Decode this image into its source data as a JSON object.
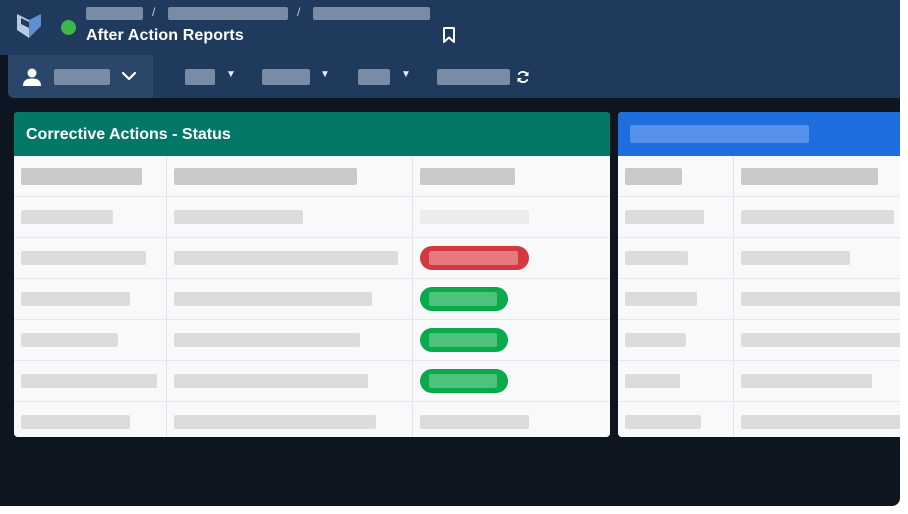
{
  "app": {
    "title": "After Action Reports",
    "breadcrumb_separator": "/",
    "status": "online",
    "colors": {
      "header_bg": "#1f3a5c",
      "status_green": "#3fb64b",
      "card_left_header": "#047866",
      "card_right_header": "#1f6ee0",
      "status_overdue": "#d6383f",
      "status_ok": "#0aa94b"
    }
  },
  "icons": {
    "logo": "logo-icon",
    "bookmark": "bookmark-icon",
    "user": "user-icon",
    "chevron": "chevron-down-icon",
    "caret": "caret-down-icon",
    "refresh": "refresh-icon"
  },
  "toolbar": {
    "caret_glyph": "▼"
  },
  "card_left": {
    "title": "Corrective Actions - Status",
    "status_values": [
      "",
      "red",
      "green",
      "green",
      "green",
      ""
    ]
  },
  "card_right": {
    "title": ""
  }
}
